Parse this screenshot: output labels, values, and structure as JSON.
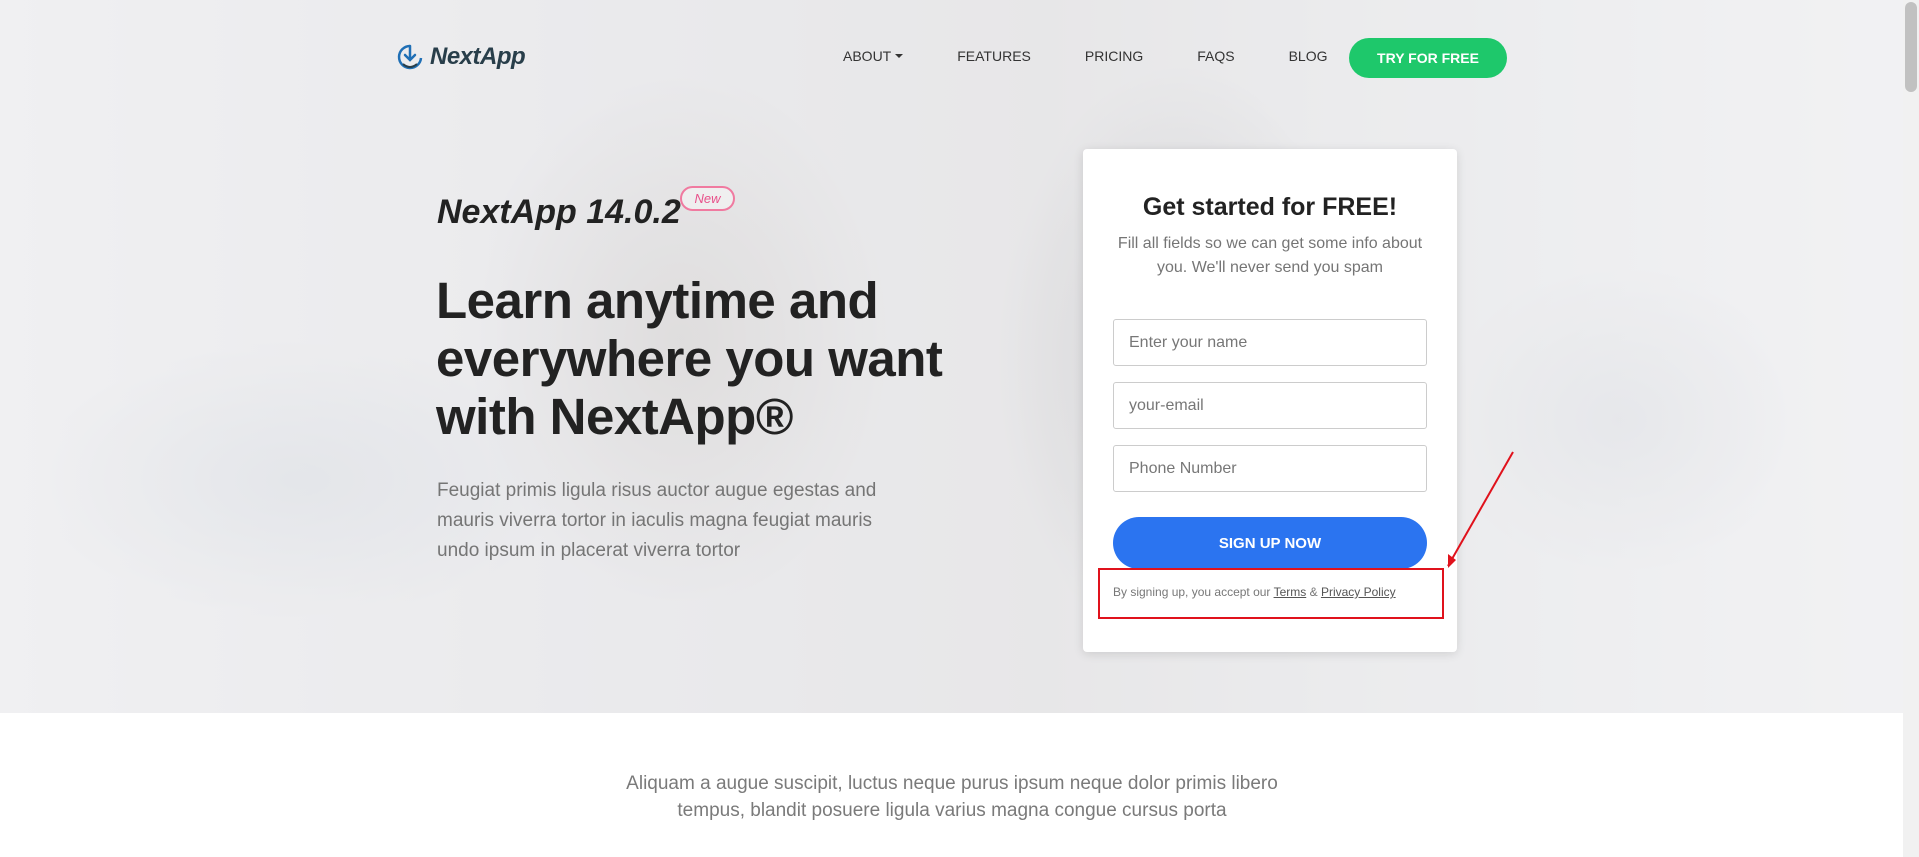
{
  "brand": {
    "name": "NextApp"
  },
  "nav": {
    "items": [
      {
        "label": "ABOUT",
        "dropdown": true
      },
      {
        "label": "FEATURES"
      },
      {
        "label": "PRICING"
      },
      {
        "label": "FAQS"
      },
      {
        "label": "BLOG"
      }
    ],
    "cta_label": "TRY FOR FREE"
  },
  "hero": {
    "version": "NextApp 14.0.2",
    "badge": "New",
    "headline": "Learn anytime and everywhere you want with NextApp®",
    "subtext": "Feugiat primis ligula risus auctor augue egestas and mauris viverra tortor in iaculis magna feugiat mauris undo ipsum in placerat viverra tortor"
  },
  "form": {
    "title": "Get started for FREE!",
    "description": "Fill all fields so we can get some info about you. We'll never send you spam",
    "name_placeholder": "Enter your name",
    "email_placeholder": "your-email",
    "phone_placeholder": "Phone Number",
    "submit_label": "SIGN UP NOW",
    "terms_prefix": "By signing up, you accept our",
    "terms_link": "Terms",
    "terms_and": "&",
    "privacy_link": "Privacy Policy"
  },
  "section": {
    "text": "Aliquam a augue suscipit, luctus neque purus ipsum neque dolor primis libero tempus, blandit posuere ligula varius magna congue cursus porta"
  },
  "colors": {
    "accent_green": "#1ec86b",
    "accent_blue": "#2b74f0",
    "badge_pink": "#e8508a",
    "annotation_red": "#e0121c"
  }
}
